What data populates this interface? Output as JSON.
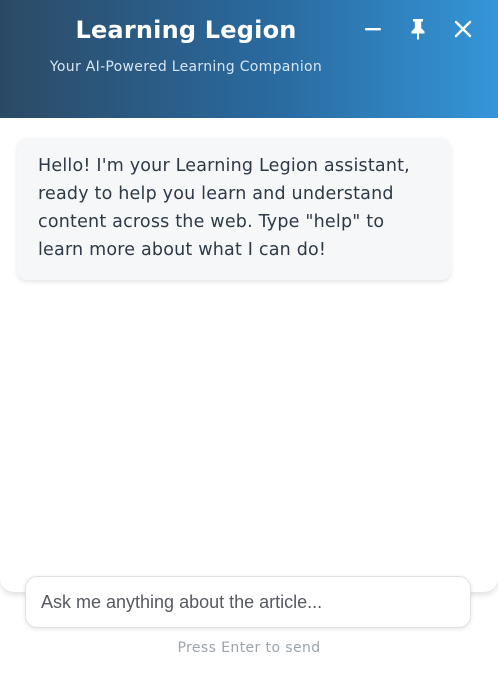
{
  "header": {
    "title": "Learning Legion",
    "subtitle": "Your AI-Powered Learning Companion",
    "buttons": {
      "minimize_icon": "minimize-icon",
      "pin_icon": "pin-icon",
      "close_icon": "close-icon"
    },
    "gradient": [
      "#2c4a66",
      "#3496d8"
    ]
  },
  "chat": {
    "messages": [
      {
        "role": "assistant",
        "text": "Hello! I'm your Learning Legion assistant, ready to help you learn and understand content across the web. Type \"help\" to learn more about what I can do!"
      }
    ]
  },
  "input": {
    "value": "",
    "placeholder": "Ask me anything about the article..."
  },
  "hint": "Press Enter to send"
}
